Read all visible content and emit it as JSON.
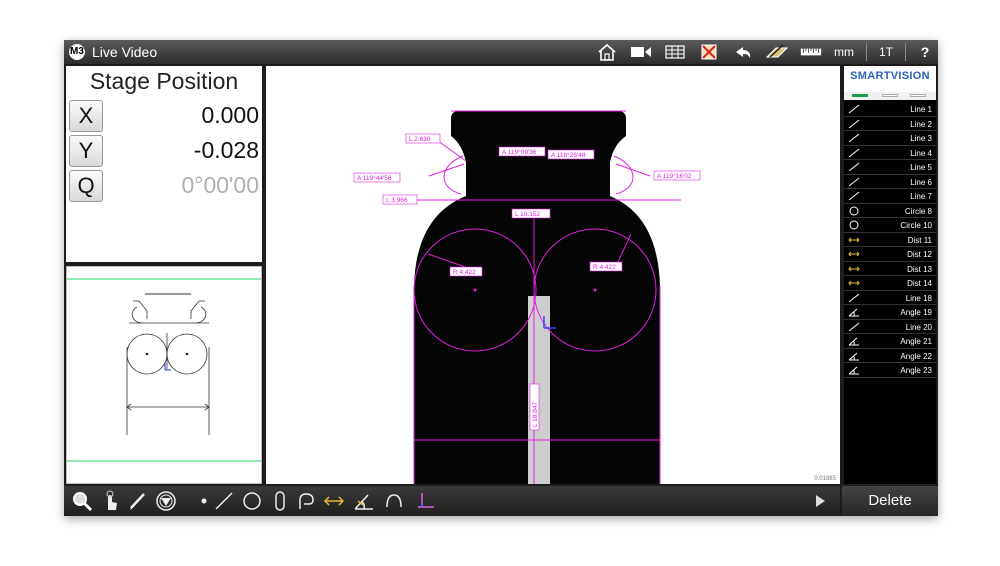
{
  "app": {
    "logo_text": "M3",
    "title": "Live Video"
  },
  "toolbar": {
    "units": "mm",
    "magnification": "1T",
    "help": "?"
  },
  "stage": {
    "title": "Stage Position",
    "axes": [
      {
        "label": "X",
        "value": "0.000"
      },
      {
        "label": "Y",
        "value": "-0.028"
      },
      {
        "label": "Q",
        "value": "0°00'00"
      }
    ]
  },
  "video": {
    "scale_label": "0.01885",
    "annotations": {
      "l1": "L  2.630",
      "a1": "A  119°09'36",
      "a2": "A  118°26'48",
      "a3": "A  119°44'56",
      "a4": "A  119°16'02",
      "l2": "L  3.966",
      "l3": "L  10.152",
      "r1": "R  4.422",
      "r2": "R  4.422",
      "l4": "L  18.847"
    }
  },
  "brand": {
    "name": "SMARTVISION"
  },
  "features": [
    {
      "label": "Line 1",
      "icon": "line-icon"
    },
    {
      "label": "Line 2",
      "icon": "line-icon"
    },
    {
      "label": "Line 3",
      "icon": "line-icon"
    },
    {
      "label": "Line 4",
      "icon": "line-icon"
    },
    {
      "label": "Line 5",
      "icon": "line-icon"
    },
    {
      "label": "Line 6",
      "icon": "line-icon"
    },
    {
      "label": "Line 7",
      "icon": "line-icon"
    },
    {
      "label": "Circle 8",
      "icon": "circle-icon"
    },
    {
      "label": "Circle 10",
      "icon": "circle-icon"
    },
    {
      "label": "Dist 11",
      "icon": "distance-icon"
    },
    {
      "label": "Dist 12",
      "icon": "distance-icon"
    },
    {
      "label": "Dist 13",
      "icon": "distance-icon"
    },
    {
      "label": "Dist 14",
      "icon": "distance-icon"
    },
    {
      "label": "Line 18",
      "icon": "line-icon"
    },
    {
      "label": "Angle 19",
      "icon": "angle-icon"
    },
    {
      "label": "Line 20",
      "icon": "line-icon"
    },
    {
      "label": "Angle 21",
      "icon": "angle-icon"
    },
    {
      "label": "Angle 22",
      "icon": "angle-icon"
    },
    {
      "label": "Angle 23",
      "icon": "angle-icon"
    }
  ],
  "actions": {
    "delete_label": "Delete"
  },
  "colors": {
    "annotation": "#e020e0",
    "accent_green": "#2fd36a",
    "brand_blue": "#2a63b8",
    "highlight_yellow": "#e8b830"
  }
}
